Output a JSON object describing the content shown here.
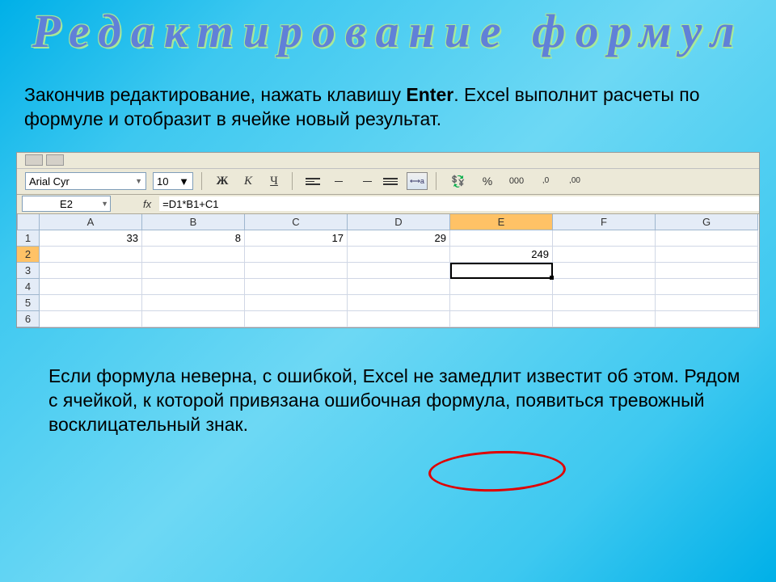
{
  "title": "Редактирование  формул",
  "intro": {
    "part1": "Закончив редактирование, нажать клавишу ",
    "bold": "Enter",
    "part2": ". Excel выполнит расчеты по формуле и отобразит в ячейке новый результат."
  },
  "toolbar": {
    "font_name": "Arial Cyr",
    "font_size": "10",
    "bold_label": "Ж",
    "italic_label": "К",
    "underline_label": "Ч",
    "percent": "%",
    "triple_zero": "000",
    "dec_inc": ",0",
    "dec_dec": ",00"
  },
  "formula_bar": {
    "name_box": "E2",
    "fx": "fx",
    "formula": "=D1*B1+C1"
  },
  "columns": [
    "A",
    "B",
    "C",
    "D",
    "E",
    "F",
    "G"
  ],
  "rows": [
    "1",
    "2",
    "3",
    "4",
    "5",
    "6"
  ],
  "grid": {
    "selected_col": "E",
    "selected_row": "2",
    "active_cell_below": "E3",
    "data": {
      "r1": {
        "A": "33",
        "B": "8",
        "C": "17",
        "D": "29"
      },
      "r2": {
        "E": "249"
      }
    }
  },
  "footer": "Если формула неверна, с ошибкой, Excel не замедлит  известит об этом. Рядом с ячейкой, к которой привязана ошибочная формула, появиться тревожный восклицательный знак."
}
